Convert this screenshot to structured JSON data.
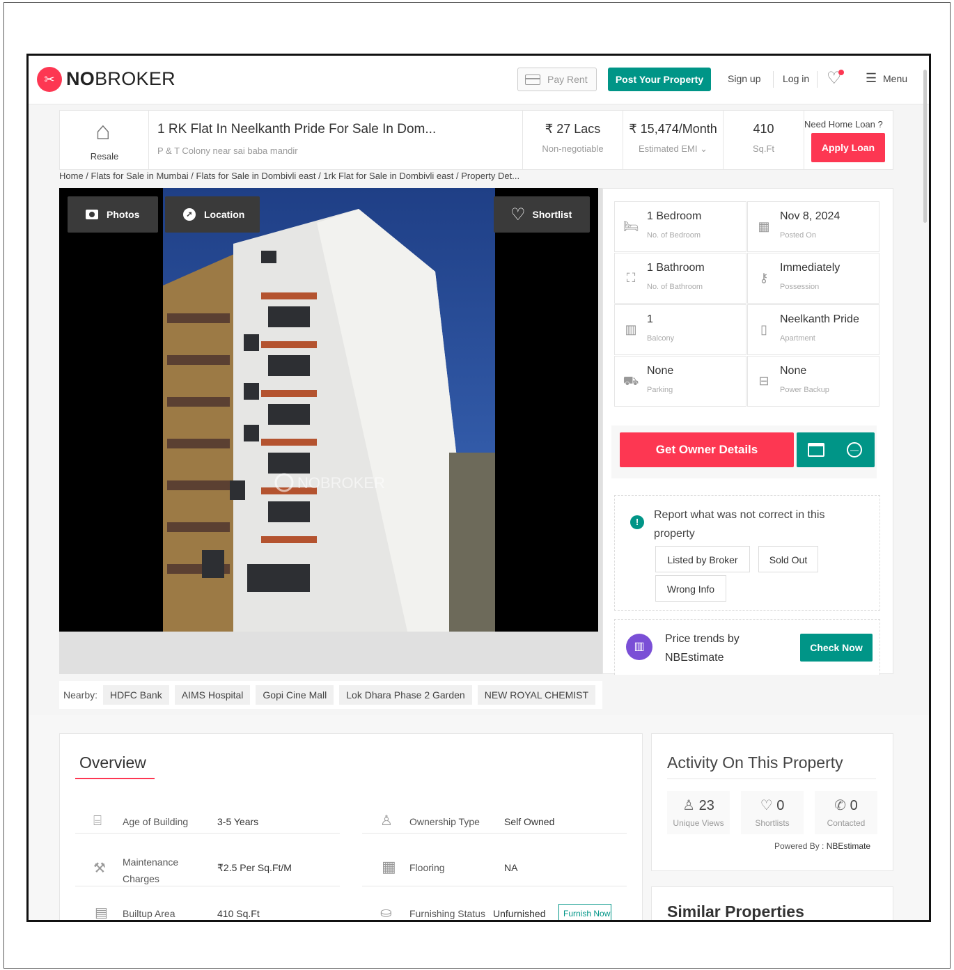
{
  "header": {
    "logo_text_bold": "NO",
    "logo_text": "BROKER",
    "pay_rent": "Pay Rent",
    "post_property": "Post Your Property",
    "signup": "Sign up",
    "login": "Log in",
    "menu": "Menu"
  },
  "property": {
    "type_label": "Resale",
    "title": "1 RK Flat In Neelkanth Pride For Sale In Dom...",
    "address": "P & T Colony near sai baba mandir",
    "price": "₹ 27 Lacs",
    "price_note": "Non-negotiable",
    "emi": "₹ 15,474/Month",
    "emi_note": "Estimated EMI",
    "area": "410",
    "area_unit": "Sq.Ft",
    "loan_question": "Need Home Loan ?",
    "apply_loan": "Apply Loan"
  },
  "breadcrumb": "Home / Flats for Sale in Mumbai / Flats for Sale in Dombivli east / 1rk Flat for Sale in Dombivli east / Property Det...",
  "gallery": {
    "photos": "Photos",
    "location": "Location",
    "shortlist": "Shortlist",
    "watermark": "NOBROKER"
  },
  "details": [
    {
      "value": "1 Bedroom",
      "label": "No. of Bedroom",
      "icon": "bed-icon"
    },
    {
      "value": "Nov 8, 2024",
      "label": "Posted On",
      "icon": "calendar-icon"
    },
    {
      "value": "1 Bathroom",
      "label": "No. of Bathroom",
      "icon": "bathtub-icon"
    },
    {
      "value": "Immediately",
      "label": "Possession",
      "icon": "key-icon"
    },
    {
      "value": "1",
      "label": "Balcony",
      "icon": "balcony-icon"
    },
    {
      "value": "Neelkanth Pride",
      "label": "Apartment",
      "icon": "building-icon"
    },
    {
      "value": "None",
      "label": "Parking",
      "icon": "car-icon"
    },
    {
      "value": "None",
      "label": "Power Backup",
      "icon": "battery-icon"
    }
  ],
  "actions": {
    "get_owner": "Get Owner Details"
  },
  "report": {
    "text": "Report what was not correct in this property",
    "buttons": [
      "Listed by Broker",
      "Sold Out",
      "Wrong Info"
    ]
  },
  "estimate": {
    "line1": "Price trends by",
    "line2": "NBEstimate",
    "button": "Check Now"
  },
  "nearby": {
    "label": "Nearby:",
    "items": [
      "HDFC Bank",
      "AIMS Hospital",
      "Gopi Cine Mall",
      "Lok Dhara Phase 2 Garden",
      "NEW ROYAL CHEMIST"
    ]
  },
  "overview": {
    "title": "Overview",
    "rows": [
      {
        "label": "Age of Building",
        "value": "3-5 Years"
      },
      {
        "label": "Ownership Type",
        "value": "Self Owned"
      },
      {
        "label": "Maintenance Charges",
        "value": "₹2.5 Per Sq.Ft/M"
      },
      {
        "label": "Flooring",
        "value": "NA"
      },
      {
        "label": "Builtup Area",
        "value": "410 Sq.Ft"
      },
      {
        "label": "Furnishing Status",
        "value": "Unfurnished"
      }
    ],
    "furnish_now": "Furnish Now"
  },
  "activity": {
    "title": "Activity On This Property",
    "views": "23",
    "views_label": "Unique Views",
    "shortlists": "0",
    "shortlists_label": "Shortlists",
    "contacted": "0",
    "contacted_label": "Contacted",
    "powered": "Powered By :",
    "powered_brand": "NBEstimate"
  },
  "similar": {
    "title": "Similar Properties"
  },
  "colors": {
    "brand_red": "#fd3752",
    "teal": "#009587"
  }
}
